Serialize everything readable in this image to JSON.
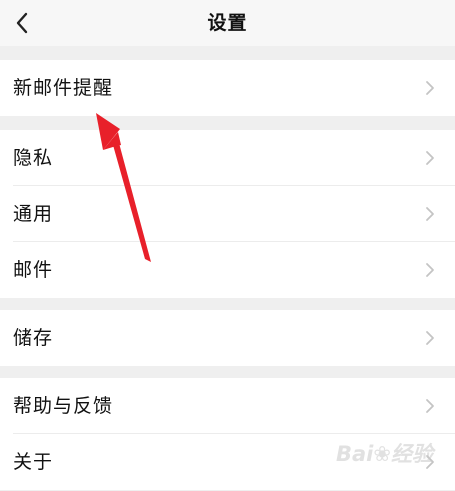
{
  "header": {
    "title": "设置",
    "back_icon": "chevron-left-icon"
  },
  "groups": [
    {
      "items": [
        {
          "label": "新邮件提醒",
          "icon": "chevron-right-icon"
        }
      ]
    },
    {
      "items": [
        {
          "label": "隐私",
          "icon": "chevron-right-icon"
        },
        {
          "label": "通用",
          "icon": "chevron-right-icon"
        },
        {
          "label": "邮件",
          "icon": "chevron-right-icon"
        }
      ]
    },
    {
      "items": [
        {
          "label": "储存",
          "icon": "chevron-right-icon"
        }
      ]
    },
    {
      "items": [
        {
          "label": "帮助与反馈",
          "icon": "chevron-right-icon"
        },
        {
          "label": "关于",
          "icon": "chevron-right-icon"
        }
      ]
    }
  ],
  "annotation": {
    "arrow_color": "#e8202a",
    "watermark": "Bai du 经验"
  },
  "colors": {
    "background": "#efefef",
    "header_bg": "#f7f7f7",
    "row_bg": "#ffffff",
    "chevron": "#c4c4c4"
  }
}
